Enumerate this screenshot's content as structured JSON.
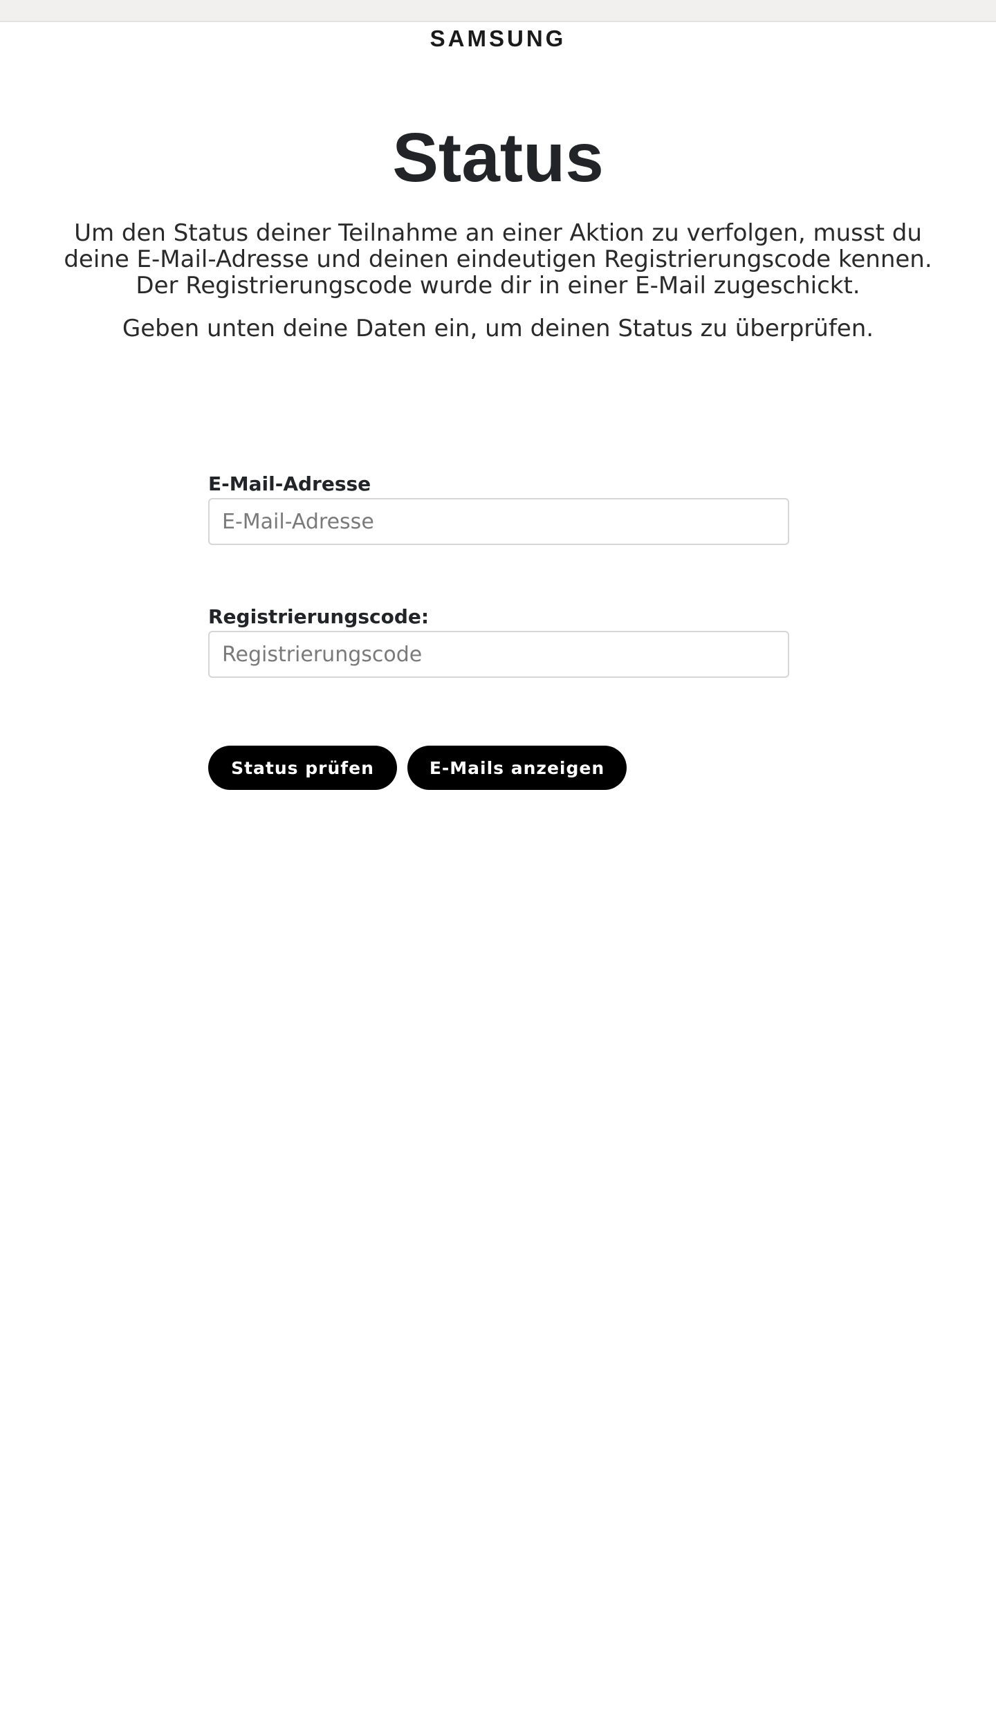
{
  "header": {
    "logo_text": "SAMSUNG"
  },
  "main": {
    "title": "Status",
    "intro": "Um den Status deiner Teilnahme an einer Aktion zu verfolgen, musst du deine E-Mail-Adresse und deinen eindeutigen Registrierungscode kennen. Der Registrierungscode wurde dir in einer E-Mail zugeschickt.",
    "instruction": "Geben unten deine Daten ein, um deinen Status zu überprüfen."
  },
  "form": {
    "email": {
      "label": "E-Mail-Adresse",
      "placeholder": "E-Mail-Adresse",
      "value": ""
    },
    "code": {
      "label": "Registrierungscode:",
      "placeholder": "Registrierungscode",
      "value": ""
    },
    "buttons": {
      "check_status": "Status prüfen",
      "show_emails": "E-Mails anzeigen"
    }
  }
}
